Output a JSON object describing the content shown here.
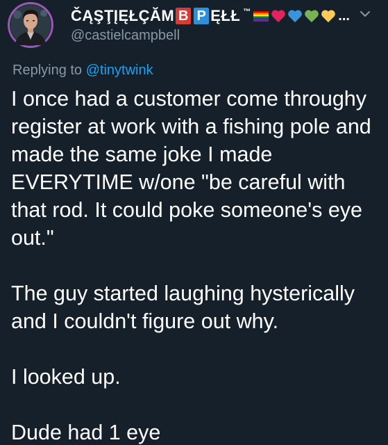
{
  "tweet": {
    "author": {
      "display_name": "ČĄŞŢĮĘŁÇĂM",
      "box_letter_1": "B",
      "box_letter_2": "P",
      "name_suffix": "ĘŁŁ",
      "trademark": "™",
      "more_indicator": "...",
      "handle": "@castielcampbell",
      "emoji": [
        "rainbow-flag-icon",
        "red-heart-icon",
        "blue-heart-icon",
        "green-heart-icon",
        "yellow-heart-icon"
      ]
    },
    "replying": {
      "prefix": "Replying to",
      "target": "@tinytwink"
    },
    "paragraphs": [
      "I once had a customer come throughy register at work with a fishing pole and made the same joke I made EVERYTIME w/one \"be careful with that rod. It could poke someone's eye out.\"",
      "The guy started laughing hysterically and I couldn't figure out why.",
      "I looked up.",
      "Dude had 1 eye"
    ]
  },
  "colors": {
    "background": "#15202b",
    "text": "#ffffff",
    "secondary": "#8899a6",
    "accent": "#1da1f2",
    "box_b": "#d93a36",
    "box_p": "#2f8fd8",
    "avatar_ring": "#9b59b6"
  }
}
